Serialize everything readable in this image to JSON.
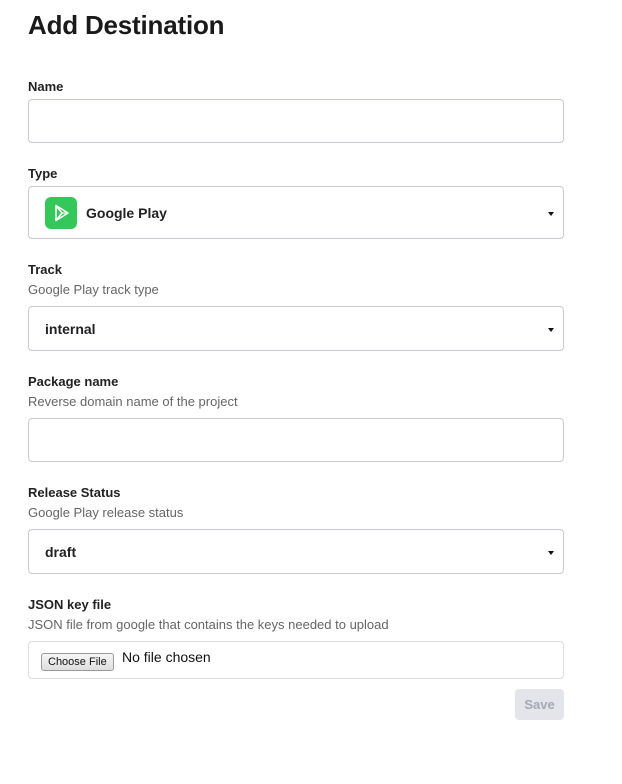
{
  "page": {
    "title": "Add Destination"
  },
  "form": {
    "name": {
      "label": "Name",
      "value": ""
    },
    "type": {
      "label": "Type",
      "selected": "Google Play",
      "icon": "google-play-icon",
      "icon_color": "#34c759"
    },
    "track": {
      "label": "Track",
      "help": "Google Play track type",
      "selected": "internal"
    },
    "package_name": {
      "label": "Package name",
      "help": "Reverse domain name of the project",
      "value": ""
    },
    "release_status": {
      "label": "Release Status",
      "help": "Google Play release status",
      "selected": "draft"
    },
    "json_key": {
      "label": "JSON key file",
      "help": "JSON file from google that contains the keys needed to upload",
      "button": "Choose File",
      "status": "No file chosen"
    }
  },
  "actions": {
    "save_label": "Save",
    "save_enabled": false
  }
}
